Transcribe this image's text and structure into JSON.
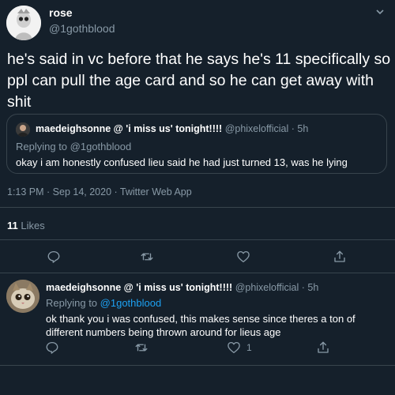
{
  "main_tweet": {
    "display_name": "rose",
    "handle": "@1gothblood",
    "text": "he's said in vc before that he says he's 11 specifically so ppl can pull the age card and so he can get away with shit",
    "timestamp": "1:13 PM · Sep 14, 2020 · Twitter Web App",
    "likes_count": "11",
    "likes_label": "Likes"
  },
  "quote": {
    "display_name": "maedeighsonne @ 'i miss us' tonight!!!!",
    "handle": "@phixelofficial",
    "time": "· 5h",
    "replying_prefix": "Replying to",
    "replying_to": "@1gothblood",
    "text": "okay i am honestly confused lieu said he had just turned 13, was he lying"
  },
  "reply_tweet": {
    "display_name": "maedeighsonne @ 'i miss us' tonight!!!!",
    "handle": "@phixelofficial",
    "time": "· 5h",
    "replying_prefix": "Replying to",
    "replying_to": "@1gothblood",
    "text": "ok thank you i was confused, this makes sense since theres a ton of different numbers being thrown around for lieus age",
    "like_count": "1"
  },
  "icons": [
    "reply-icon",
    "retweet-icon",
    "like-icon",
    "share-icon",
    "chevron-down-icon"
  ],
  "colors": {
    "background": "#15202b",
    "text": "#ffffff",
    "muted": "#8899a6",
    "link": "#1da1f2",
    "border": "#38444d"
  }
}
